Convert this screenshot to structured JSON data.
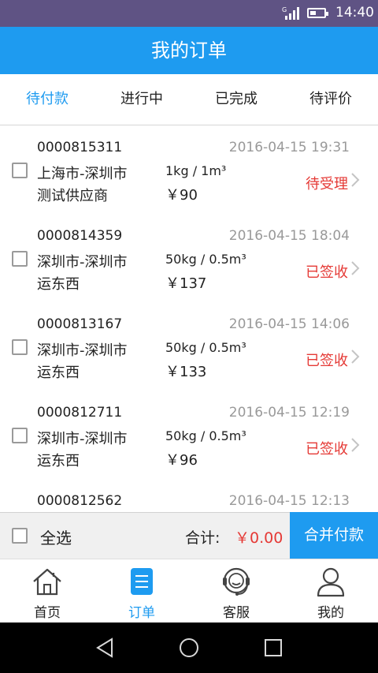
{
  "status_bar": {
    "signal_label": "G",
    "time": "14:40",
    "battery_level": 0.45
  },
  "header": {
    "title": "我的订单"
  },
  "tabs": [
    {
      "label": "待付款",
      "active": true
    },
    {
      "label": "进行中",
      "active": false
    },
    {
      "label": "已完成",
      "active": false
    },
    {
      "label": "待评价",
      "active": false
    }
  ],
  "orders": [
    {
      "order_no": "0000815311",
      "datetime": "2016-04-15 19:31",
      "route": "上海市-深圳市",
      "company": "测试供应商",
      "weight_volume": "1kg / 1m³",
      "price": "￥90",
      "status": "待受理"
    },
    {
      "order_no": "0000814359",
      "datetime": "2016-04-15 18:04",
      "route": "深圳市-深圳市",
      "company": "运东西",
      "weight_volume": "50kg / 0.5m³",
      "price": "￥137",
      "status": "已签收"
    },
    {
      "order_no": "0000813167",
      "datetime": "2016-04-15 14:06",
      "route": "深圳市-深圳市",
      "company": "运东西",
      "weight_volume": "50kg / 0.5m³",
      "price": "￥133",
      "status": "已签收"
    },
    {
      "order_no": "0000812711",
      "datetime": "2016-04-15 12:19",
      "route": "深圳市-深圳市",
      "company": "运东西",
      "weight_volume": "50kg / 0.5m³",
      "price": "￥96",
      "status": "已签收"
    },
    {
      "order_no": "0000812562",
      "datetime": "2016-04-15 12:13",
      "route": "",
      "company": "",
      "weight_volume": "",
      "price": "",
      "status": ""
    }
  ],
  "pay_bar": {
    "select_all_label": "全选",
    "total_label": "合计:",
    "total_value": "￥0.00",
    "pay_button_label": "合并付款"
  },
  "bottom_nav": [
    {
      "label": "首页",
      "icon": "home-icon",
      "active": false
    },
    {
      "label": "订单",
      "icon": "orders-icon",
      "active": true
    },
    {
      "label": "客服",
      "icon": "customer-service-icon",
      "active": false
    },
    {
      "label": "我的",
      "icon": "profile-icon",
      "active": false
    }
  ],
  "colors": {
    "accent": "#1e9bf0",
    "status_red": "#e53935",
    "status_bar": "#5f5384"
  }
}
